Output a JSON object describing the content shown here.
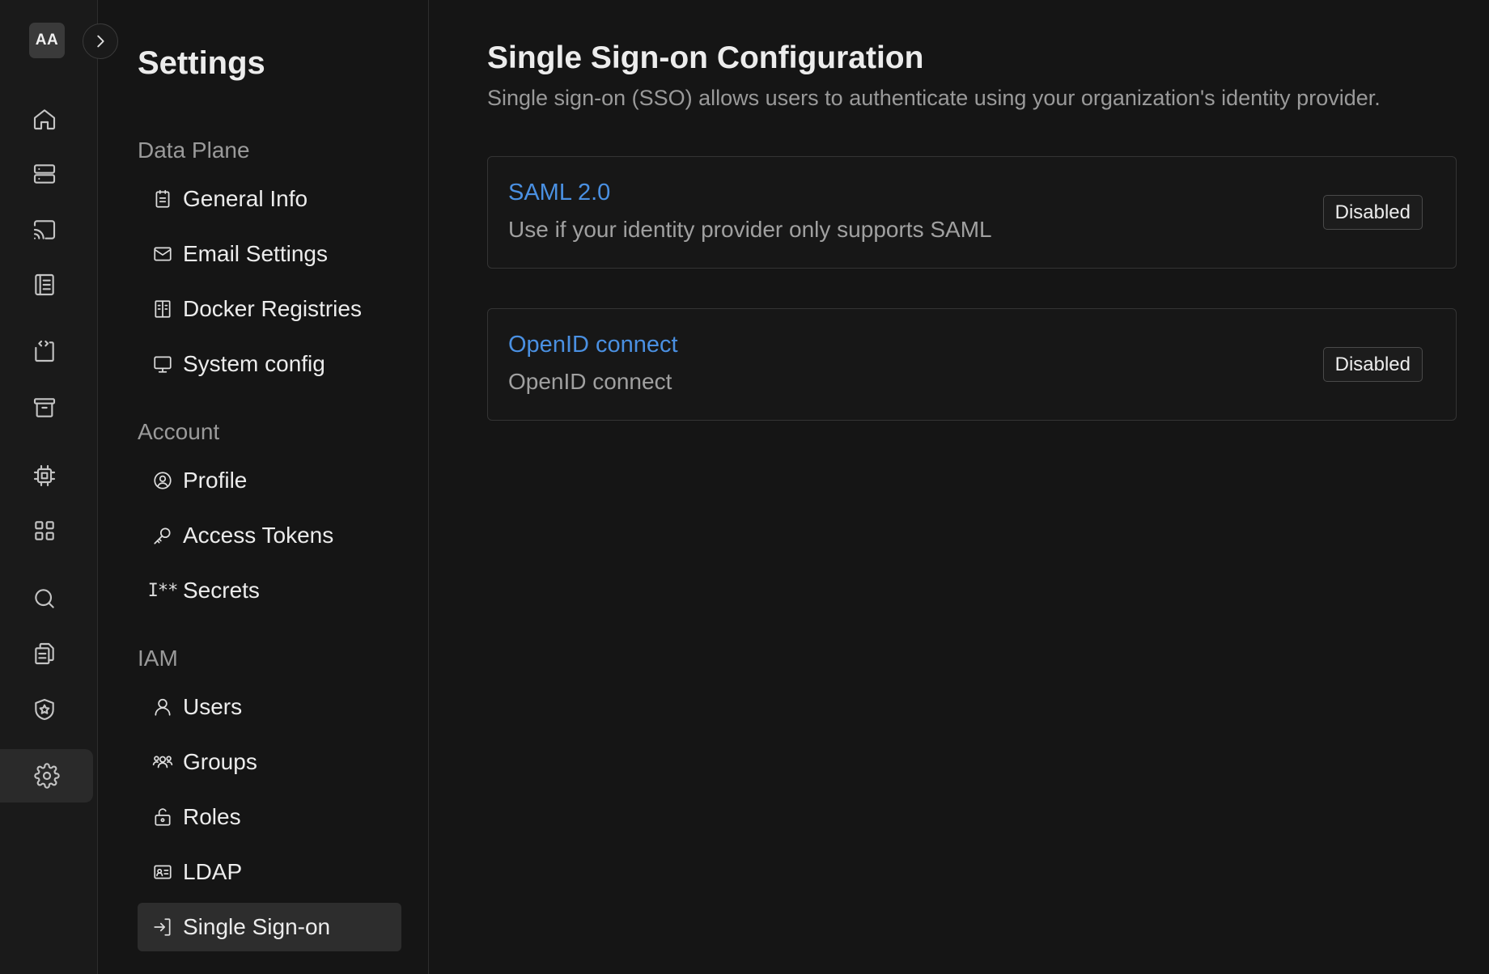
{
  "rail": {
    "avatar_initials": "AA",
    "icons": [
      "home-icon",
      "server-icon",
      "cast-icon",
      "notebook-icon",
      "code-file-icon",
      "archive-icon",
      "chip-icon",
      "apps-grid-icon",
      "search-icon",
      "copy-document-icon",
      "shield-star-icon",
      "settings-gear-icon"
    ],
    "active": "settings-gear-icon"
  },
  "panel": {
    "title": "Settings",
    "sections": [
      {
        "label": "Data Plane",
        "items": [
          {
            "label": "General Info",
            "icon": "clipboard-icon"
          },
          {
            "label": "Email Settings",
            "icon": "mail-icon"
          },
          {
            "label": "Docker Registries",
            "icon": "book-open-icon"
          },
          {
            "label": "System config",
            "icon": "monitor-icon"
          }
        ]
      },
      {
        "label": "Account",
        "items": [
          {
            "label": "Profile",
            "icon": "user-circle-icon"
          },
          {
            "label": "Access Tokens",
            "icon": "key-icon"
          },
          {
            "label": "Secrets",
            "icon": "password-icon",
            "glyph": "I**"
          }
        ]
      },
      {
        "label": "IAM",
        "items": [
          {
            "label": "Users",
            "icon": "user-icon"
          },
          {
            "label": "Groups",
            "icon": "users-group-icon"
          },
          {
            "label": "Roles",
            "icon": "lock-open-icon"
          },
          {
            "label": "LDAP",
            "icon": "id-card-icon"
          },
          {
            "label": "Single Sign-on",
            "icon": "login-icon",
            "active": true
          }
        ]
      }
    ]
  },
  "main": {
    "title": "Single Sign-on Configuration",
    "subtitle": "Single sign-on (SSO) allows users to authenticate using your organization's identity provider.",
    "providers": [
      {
        "name": "SAML 2.0",
        "description": "Use if your identity provider only supports SAML",
        "status": "Disabled"
      },
      {
        "name": "OpenID connect",
        "description": "OpenID connect",
        "status": "Disabled"
      }
    ]
  },
  "colors": {
    "background": "#151515",
    "rail_background": "#1a1a1a",
    "link_blue": "#4a90e2",
    "muted_text": "#9a9a9a",
    "active_item": "#2d2d2d"
  }
}
